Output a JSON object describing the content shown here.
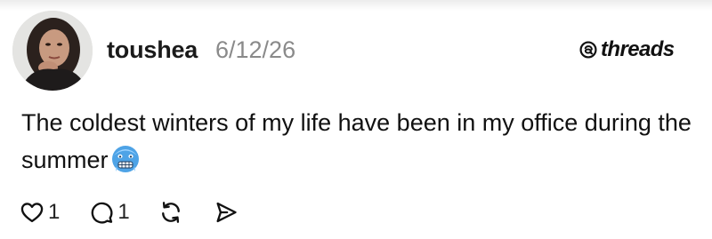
{
  "post": {
    "author": {
      "username": "toushea",
      "avatar_icon": "user-avatar"
    },
    "date": "6/12/26",
    "brand": {
      "name": "threads",
      "icon": "threads-logo-icon"
    },
    "text": "The coldest winters of my life have been in my office during the summer",
    "emoji": "cold-face-emoji",
    "actions": {
      "likes": "1",
      "replies": "1",
      "repost_icon": "repost-icon",
      "share_icon": "share-icon"
    }
  },
  "colors": {
    "text": "#111111",
    "muted": "#8a8a8a",
    "emoji_face": "#4ea3e6"
  }
}
